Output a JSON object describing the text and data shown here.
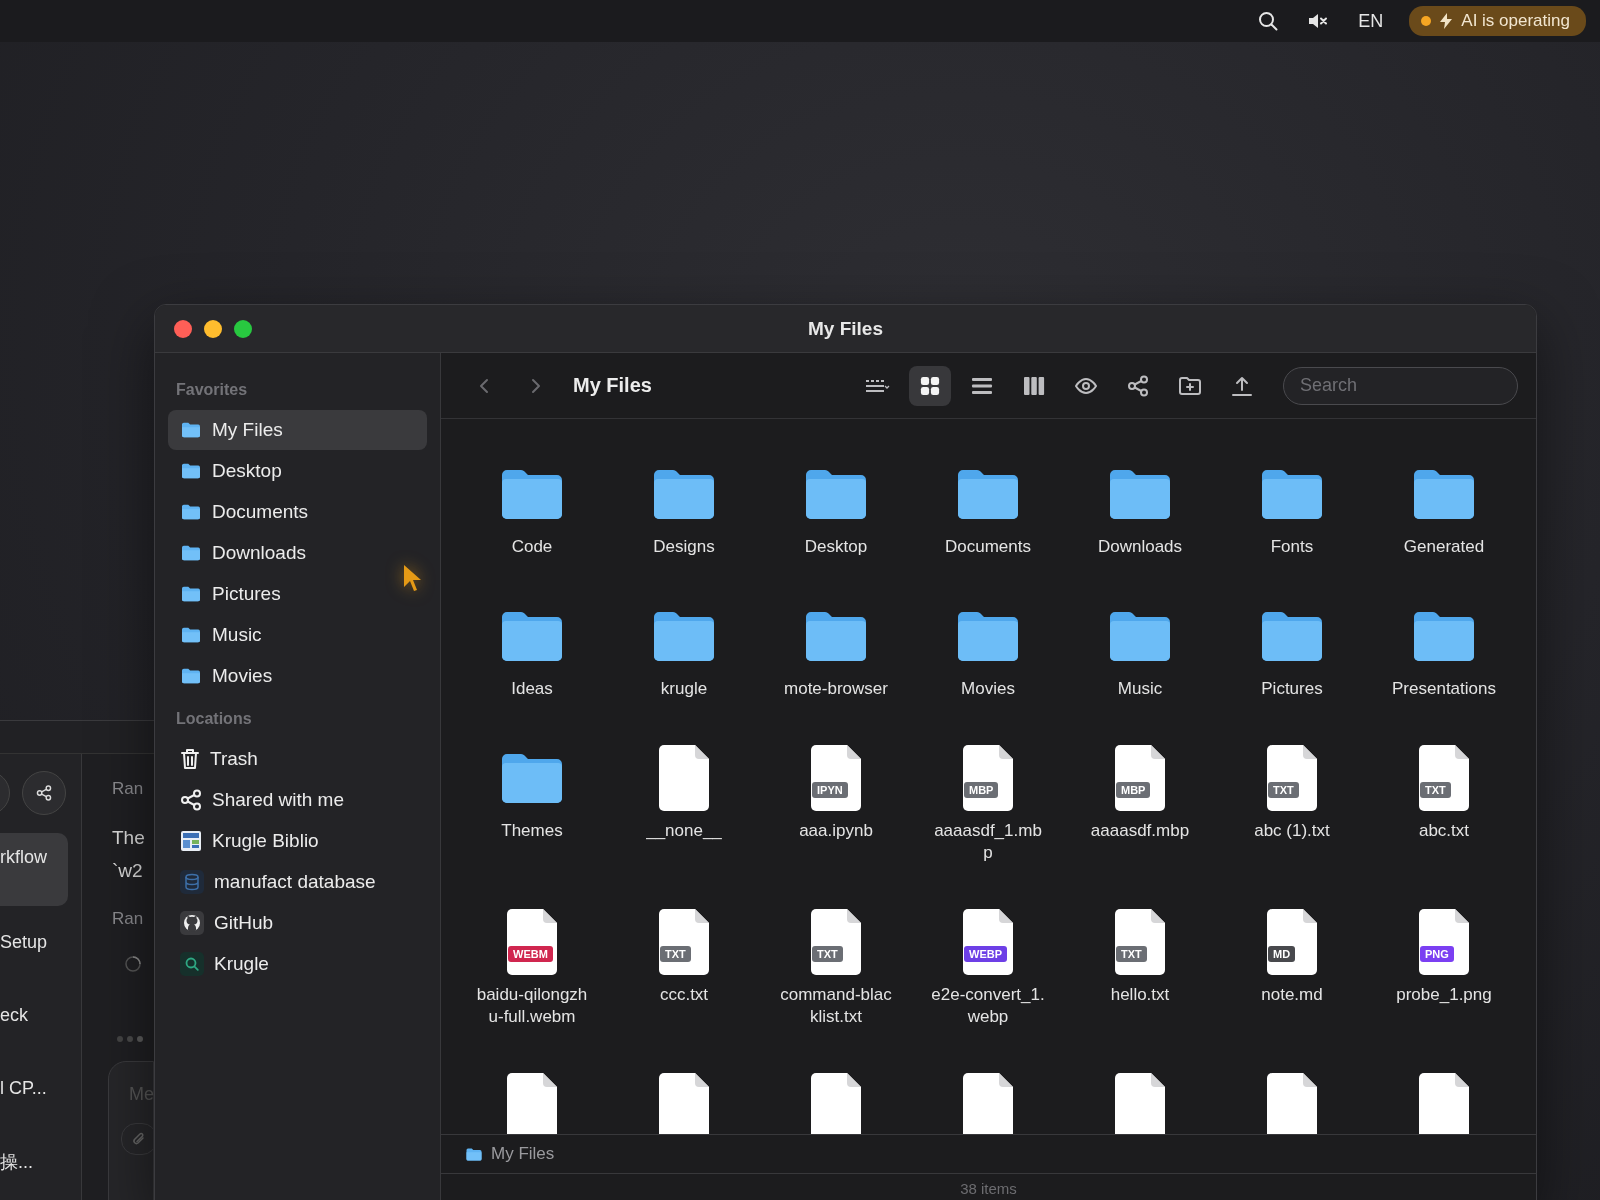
{
  "menubar": {
    "language": "EN",
    "status": {
      "text": "AI is operating",
      "active": true
    }
  },
  "background_window": {
    "sidebar_items": [
      {
        "label": "rkflow",
        "selected": true
      },
      {
        "label": "Setup",
        "selected": false
      },
      {
        "label": "eck",
        "selected": false
      },
      {
        "label": "l CP...",
        "selected": false
      },
      {
        "label": "操...",
        "selected": false
      }
    ],
    "messages": [
      {
        "kind": "status",
        "text": "Ran"
      },
      {
        "kind": "text",
        "lines": [
          "The",
          "`w2"
        ]
      },
      {
        "kind": "status",
        "text": "Ran"
      },
      {
        "kind": "spinner"
      },
      {
        "kind": "typing"
      }
    ],
    "input": {
      "placeholder": "Me"
    }
  },
  "window": {
    "title": "My Files"
  },
  "sidebar": {
    "sections": [
      {
        "title": "Favorites",
        "items": [
          {
            "label": "My Files",
            "kind": "folder",
            "selected": true
          },
          {
            "label": "Desktop",
            "kind": "folder",
            "selected": false
          },
          {
            "label": "Documents",
            "kind": "folder",
            "selected": false
          },
          {
            "label": "Downloads",
            "kind": "folder",
            "selected": false
          },
          {
            "label": "Pictures",
            "kind": "folder",
            "selected": false
          },
          {
            "label": "Music",
            "kind": "folder",
            "selected": false
          },
          {
            "label": "Movies",
            "kind": "folder",
            "selected": false
          }
        ]
      },
      {
        "title": "Locations",
        "items": [
          {
            "label": "Trash",
            "kind": "trash",
            "selected": false
          },
          {
            "label": "Shared with me",
            "kind": "share",
            "selected": false
          },
          {
            "label": "Krugle Biblio",
            "kind": "image",
            "selected": false
          },
          {
            "label": "manufact database",
            "kind": "database",
            "selected": false
          },
          {
            "label": "GitHub",
            "kind": "cat",
            "selected": false
          },
          {
            "label": "Krugle",
            "kind": "search",
            "selected": false
          }
        ]
      }
    ]
  },
  "toolbar": {
    "nav": [
      {
        "kind": "back"
      },
      {
        "kind": "forward"
      }
    ],
    "title": "My Files",
    "views": [
      {
        "kind": "options",
        "selected": false
      },
      {
        "kind": "grid",
        "selected": true
      },
      {
        "kind": "list",
        "selected": false
      },
      {
        "kind": "columns",
        "selected": false
      }
    ],
    "actions": [
      {
        "kind": "preview"
      },
      {
        "kind": "share"
      },
      {
        "kind": "new-folder"
      },
      {
        "kind": "upload"
      }
    ],
    "search": {
      "placeholder": "Search"
    }
  },
  "items": [
    {
      "kind": "folder",
      "name": "Code"
    },
    {
      "kind": "folder",
      "name": "Designs"
    },
    {
      "kind": "folder",
      "name": "Desktop"
    },
    {
      "kind": "folder",
      "name": "Documents"
    },
    {
      "kind": "folder",
      "name": "Downloads"
    },
    {
      "kind": "folder",
      "name": "Fonts"
    },
    {
      "kind": "folder",
      "name": "Generated"
    },
    {
      "kind": "folder",
      "name": "Ideas"
    },
    {
      "kind": "folder",
      "name": "krugle"
    },
    {
      "kind": "folder",
      "name": "mote-browser"
    },
    {
      "kind": "folder",
      "name": "Movies"
    },
    {
      "kind": "folder",
      "name": "Music"
    },
    {
      "kind": "folder",
      "name": "Pictures"
    },
    {
      "kind": "folder",
      "name": "Presentations"
    },
    {
      "kind": "folder",
      "name": "Themes"
    },
    {
      "kind": "file",
      "name": "__none__"
    },
    {
      "kind": "file",
      "name": "aaa.ipynb",
      "badge": "IPYN",
      "color": "#6b6e74"
    },
    {
      "kind": "file",
      "name": "aaaasdf_1.mbp",
      "badge": "MBP",
      "color": "#6b6e74"
    },
    {
      "kind": "file",
      "name": "aaaasdf.mbp",
      "badge": "MBP",
      "color": "#6b6e74"
    },
    {
      "kind": "file",
      "name": "abc (1).txt",
      "badge": "TXT",
      "color": "#6b6e74"
    },
    {
      "kind": "file",
      "name": "abc.txt",
      "badge": "TXT",
      "color": "#6b6e74"
    },
    {
      "kind": "file",
      "name": "baidu-qilongzhu-full.webm",
      "badge": "WEBM",
      "color": "#d0264f"
    },
    {
      "kind": "file",
      "name": "ccc.txt",
      "badge": "TXT",
      "color": "#6b6e74"
    },
    {
      "kind": "file",
      "name": "command-blacklist.txt",
      "badge": "TXT",
      "color": "#6b6e74"
    },
    {
      "kind": "file",
      "name": "e2e-convert_1.webp",
      "badge": "WEBP",
      "color": "#6d3fe6"
    },
    {
      "kind": "file",
      "name": "hello.txt",
      "badge": "TXT",
      "color": "#6b6e74"
    },
    {
      "kind": "file",
      "name": "note.md",
      "badge": "MD",
      "color": "#48494d"
    },
    {
      "kind": "file",
      "name": "probe_1.png",
      "badge": "PNG",
      "color": "#7b3ff2"
    },
    {
      "kind": "file"
    },
    {
      "kind": "file"
    },
    {
      "kind": "file"
    },
    {
      "kind": "file"
    },
    {
      "kind": "file"
    },
    {
      "kind": "file"
    },
    {
      "kind": "file"
    }
  ],
  "path_bar": {
    "label": "My Files"
  },
  "status_bar": "38 items"
}
